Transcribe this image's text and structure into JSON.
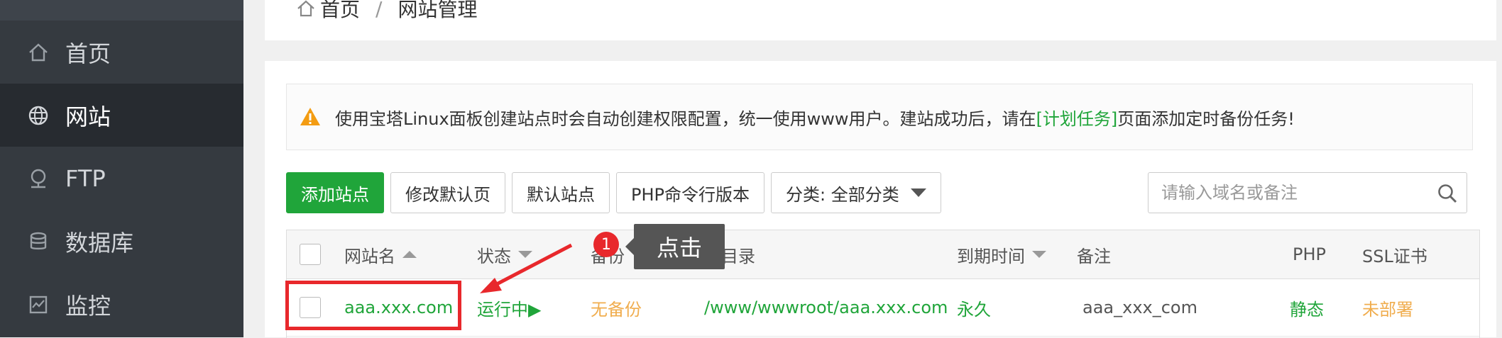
{
  "sidebar": {
    "items": [
      {
        "label": "首页",
        "icon": "home-icon",
        "active": false
      },
      {
        "label": "网站",
        "icon": "globe-icon",
        "active": true
      },
      {
        "label": "FTP",
        "icon": "ftp-icon",
        "active": false
      },
      {
        "label": "数据库",
        "icon": "database-icon",
        "active": false
      },
      {
        "label": "监控",
        "icon": "monitor-icon",
        "active": false
      }
    ]
  },
  "breadcrumb": {
    "home": "首页",
    "separator": "/",
    "current": "网站管理"
  },
  "alert": {
    "text_before": "使用宝塔Linux面板创建站点时会自动创建权限配置，统一使用www用户。建站成功后，请在",
    "link": "[计划任务]",
    "text_after": "页面添加定时备份任务!"
  },
  "toolbar": {
    "add_site": "添加站点",
    "edit_default_page": "修改默认页",
    "default_site": "默认站点",
    "php_cli_version": "PHP命令行版本",
    "category": "分类: 全部分类"
  },
  "search": {
    "placeholder": "请输入域名或备注"
  },
  "table": {
    "headers": {
      "name": "网站名",
      "status": "状态",
      "backup": "备份",
      "root": "根目录",
      "expire": "到期时间",
      "remark": "备注",
      "php": "PHP",
      "ssl": "SSL证书"
    },
    "rows": [
      {
        "name": "aaa.xxx.com",
        "status": "运行中▶",
        "backup": "无备份",
        "root": "/www/wwwroot/aaa.xxx.com",
        "expire": "永久",
        "remark": "aaa_xxx_com",
        "php": "静态",
        "ssl": "未部署"
      }
    ]
  },
  "annotation": {
    "step_number": "1",
    "tooltip": "点击"
  },
  "colors": {
    "accent": "#20a53a",
    "warning": "#f0ad4e",
    "annotation_red": "#e8282c",
    "sidebar_bg": "#353a40",
    "sidebar_active_bg": "#272b30"
  }
}
